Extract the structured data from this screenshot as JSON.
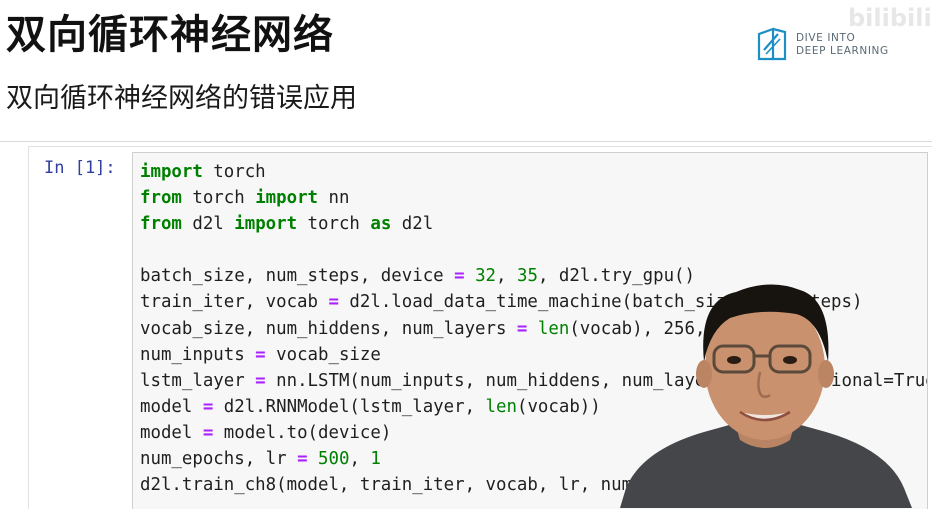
{
  "slide": {
    "title": "双向循环神经网络",
    "subtitle": "双向循环神经网络的错误应用"
  },
  "logo": {
    "line1": "DIVE INTO",
    "line2": "DEEP LEARNING",
    "icon": "book-icon",
    "color": "#1c8fc6"
  },
  "watermark": {
    "text": "bilibili"
  },
  "cell": {
    "prompt": "In [1]:",
    "lines": [
      [
        [
          "kw",
          "import"
        ],
        [
          "t",
          " torch"
        ]
      ],
      [
        [
          "kw",
          "from"
        ],
        [
          "t",
          " torch "
        ],
        [
          "kw",
          "import"
        ],
        [
          "t",
          " nn"
        ]
      ],
      [
        [
          "kw",
          "from"
        ],
        [
          "t",
          " d2l "
        ],
        [
          "kw",
          "import"
        ],
        [
          "t",
          " torch "
        ],
        [
          "kw",
          "as"
        ],
        [
          "t",
          " d2l"
        ]
      ],
      [],
      [
        [
          "t",
          "batch_size, num_steps, device "
        ],
        [
          "op",
          "="
        ],
        [
          "t",
          " "
        ],
        [
          "num",
          "32"
        ],
        [
          "t",
          ", "
        ],
        [
          "num",
          "35"
        ],
        [
          "t",
          ", d2l.try_gpu()"
        ]
      ],
      [
        [
          "t",
          "train_iter, vocab "
        ],
        [
          "op",
          "="
        ],
        [
          "t",
          " d2l.load_data_time_machine(batch_size, num_steps)"
        ]
      ],
      [
        [
          "t",
          "vocab_size, num_hiddens, num_layers "
        ],
        [
          "op",
          "="
        ],
        [
          "t",
          " "
        ],
        [
          "bi",
          "len"
        ],
        [
          "t",
          "(vocab), 256, 2"
        ]
      ],
      [
        [
          "t",
          "num_inputs "
        ],
        [
          "op",
          "="
        ],
        [
          "t",
          " vocab_size"
        ]
      ],
      [
        [
          "t",
          "lstm_layer "
        ],
        [
          "op",
          "="
        ],
        [
          "t",
          " nn.LSTM(num_inputs, num_hiddens, num_layers, bidirectional=True)"
        ]
      ],
      [
        [
          "t",
          "model "
        ],
        [
          "op",
          "="
        ],
        [
          "t",
          " d2l.RNNModel(lstm_layer, "
        ],
        [
          "bi",
          "len"
        ],
        [
          "t",
          "(vocab))"
        ]
      ],
      [
        [
          "t",
          "model "
        ],
        [
          "op",
          "="
        ],
        [
          "t",
          " model.to(device)"
        ]
      ],
      [
        [
          "t",
          "num_epochs, lr "
        ],
        [
          "op",
          "="
        ],
        [
          "t",
          " "
        ],
        [
          "num",
          "500"
        ],
        [
          "t",
          ", "
        ],
        [
          "num",
          "1"
        ]
      ],
      [
        [
          "t",
          "d2l.train_ch8(model, train_iter, vocab, lr, num_epochs, device)"
        ]
      ]
    ]
  },
  "colors": {
    "keyword": "#008000",
    "operator": "#aa22ff",
    "prompt": "#303f9f",
    "cell_background": "#f7f7f7"
  }
}
